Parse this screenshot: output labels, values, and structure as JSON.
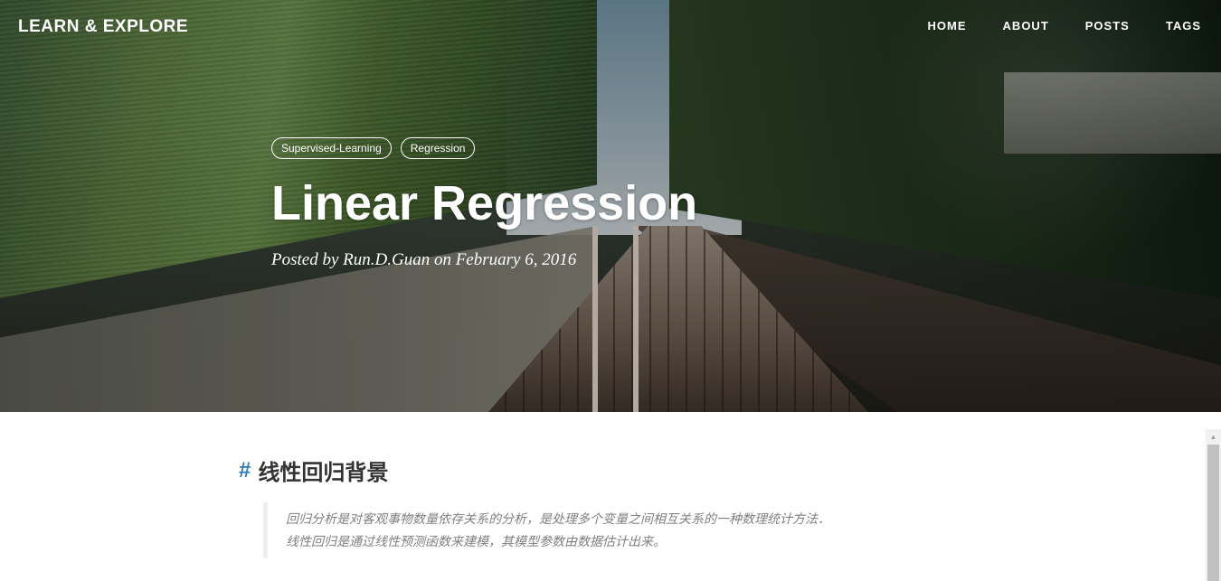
{
  "nav": {
    "brand": "LEARN & EXPLORE",
    "links": [
      "HOME",
      "ABOUT",
      "POSTS",
      "TAGS"
    ]
  },
  "post": {
    "tags": [
      "Supervised-Learning",
      "Regression"
    ],
    "title": "Linear Regression",
    "meta": "Posted by Run.D.Guan on February 6, 2016"
  },
  "content": {
    "anchor": "#",
    "heading": "线性回归背景",
    "quote_lines": [
      "回归分析是对客观事物数量依存关系的分析，是处理多个变量之间相互关系的一种数理统计方法．",
      "线性回归是通过线性预测函数来建模，其模型参数由数据估计出来。"
    ]
  },
  "colors": {
    "accent": "#337ab7",
    "text": "#333333",
    "quote_text": "#808080"
  }
}
